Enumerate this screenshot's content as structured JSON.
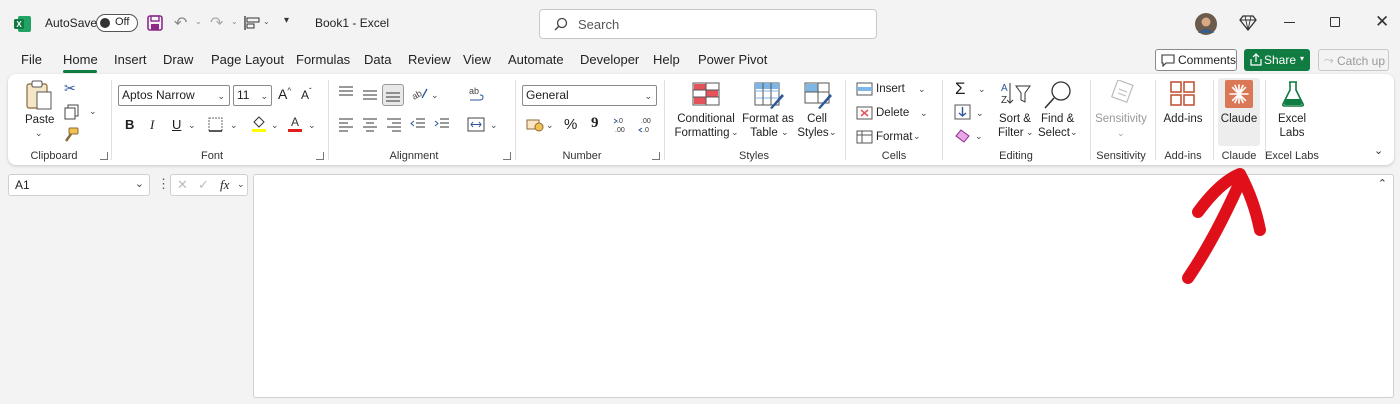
{
  "titlebar": {
    "autosave_label": "AutoSave",
    "autosave_state": "Off",
    "doc_title": "Book1  -  Excel",
    "search_placeholder": "Search"
  },
  "tabs": [
    "File",
    "Home",
    "Insert",
    "Draw",
    "Page Layout",
    "Formulas",
    "Data",
    "Review",
    "View",
    "Automate",
    "Developer",
    "Help",
    "Power Pivot"
  ],
  "active_tab": "Home",
  "actions": {
    "comments": "Comments",
    "share": "Share",
    "catch_up": "Catch up"
  },
  "ribbon": {
    "clipboard": {
      "label": "Clipboard",
      "paste": "Paste"
    },
    "font": {
      "label": "Font",
      "font_name": "Aptos Narrow",
      "font_size": "11",
      "bold": "B",
      "italic": "I",
      "underline": "U"
    },
    "alignment": {
      "label": "Alignment"
    },
    "number": {
      "label": "Number",
      "format": "General",
      "percent": "%",
      "comma": "9"
    },
    "styles": {
      "label": "Styles",
      "conditional_1": "Conditional",
      "conditional_2": "Formatting",
      "format_table_1": "Format as",
      "format_table_2": "Table",
      "cell_styles_1": "Cell",
      "cell_styles_2": "Styles"
    },
    "cells": {
      "label": "Cells",
      "insert": "Insert",
      "delete": "Delete",
      "format": "Format"
    },
    "editing": {
      "label": "Editing",
      "sort_1": "Sort &",
      "sort_2": "Filter",
      "find_1": "Find &",
      "find_2": "Select"
    },
    "sensitivity": {
      "label": "Sensitivity",
      "button": "Sensitivity"
    },
    "addins": {
      "label": "Add-ins",
      "button": "Add-ins"
    },
    "claude": {
      "label": "Claude",
      "button": "Claude"
    },
    "excel_labs": {
      "label": "Excel Labs",
      "button_1": "Excel",
      "button_2": "Labs"
    }
  },
  "formula_bar": {
    "name_box": "A1",
    "fx": "fx"
  },
  "colors": {
    "excel_green": "#107c41",
    "claude_orange": "#d97757",
    "annotation_red": "#e0101a"
  }
}
